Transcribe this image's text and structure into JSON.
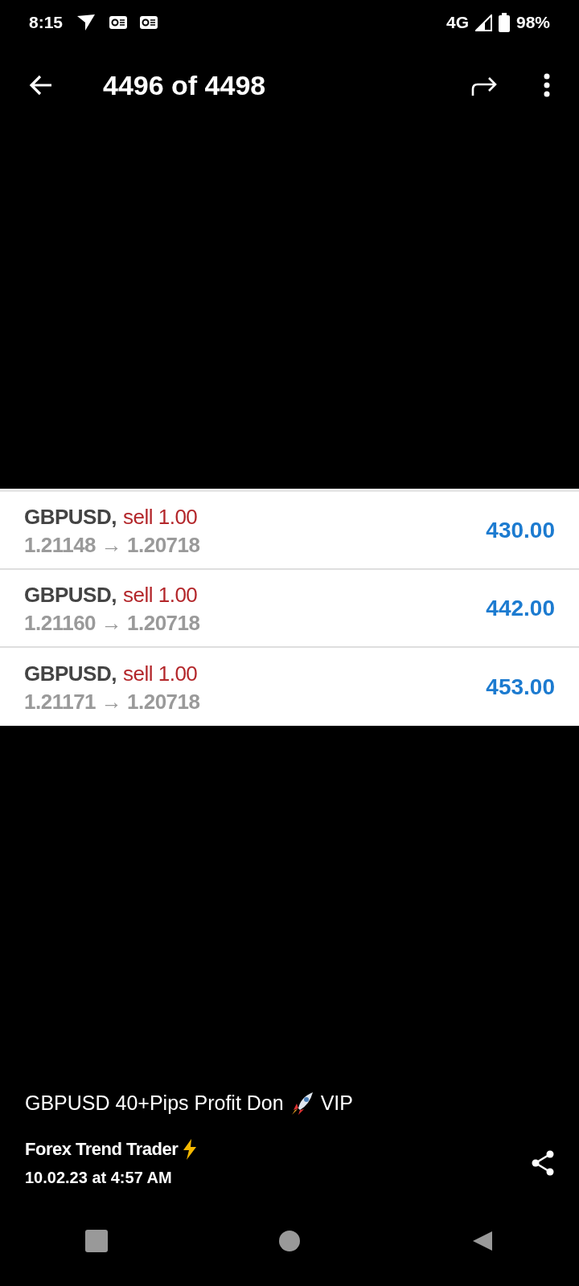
{
  "status_bar": {
    "time": "8:15",
    "network": "4G",
    "battery": "98%"
  },
  "toolbar": {
    "title": "4496 of 4498"
  },
  "trades": [
    {
      "symbol": "GBPUSD,",
      "action": "sell 1.00",
      "prices": "1.21148 → 1.20718",
      "profit": "430.00"
    },
    {
      "symbol": "GBPUSD,",
      "action": "sell 1.00",
      "prices": "1.21160 → 1.20718",
      "profit": "442.00"
    },
    {
      "symbol": "GBPUSD,",
      "action": "sell 1.00",
      "prices": "1.21171 → 1.20718",
      "profit": "453.00"
    }
  ],
  "caption": {
    "text": "GBPUSD 40+Pips Profit Don",
    "suffix": "VIP"
  },
  "author": "Forex Trend Trader",
  "date": "10.02.23 at 4:57 AM"
}
